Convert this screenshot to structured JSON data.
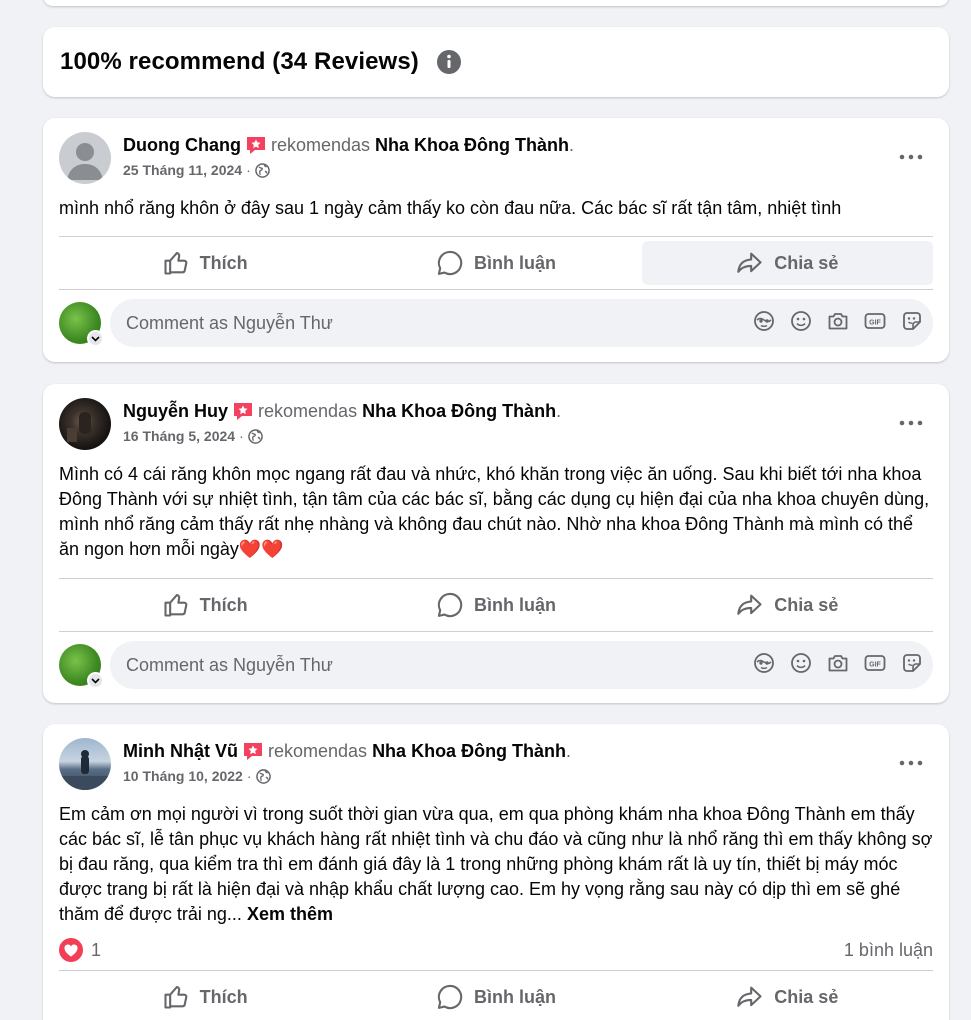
{
  "summary": {
    "title": "100% recommend (34 Reviews)"
  },
  "comment_placeholder": "Comment as Nguyễn Thư",
  "actions": {
    "like": "Thích",
    "comment": "Bình luận",
    "share": "Chia sẻ"
  },
  "reviews": [
    {
      "author": "Duong Chang",
      "recommends": "rekomendas",
      "page": "Nha Khoa Đông Thành",
      "date": "25 Tháng 11, 2024",
      "text": "mình nhổ răng khôn ở đây sau 1 ngày cảm thấy ko còn đau nữa. Các bác sĩ rất tận tâm, nhiệt tình"
    },
    {
      "author": "Nguyễn Huy",
      "recommends": "rekomendas",
      "page": "Nha Khoa Đông Thành",
      "date": "16 Tháng 5, 2024",
      "text": "Mình có 4 cái răng khôn mọc ngang rất đau và nhức, khó khăn trong việc ăn uống. Sau khi biết tới nha khoa Đông Thành với sự nhiệt tình, tận tâm của các bác sĩ, bằng các dụng cụ hiện đại của nha khoa chuyên dùng, mình nhổ răng cảm thấy rất nhẹ nhàng và không đau chút nào. Nhờ nha khoa Đông Thành mà mình có thể ăn ngon hơn mỗi ngày❤️❤️"
    },
    {
      "author": "Minh Nhật Vũ",
      "recommends": "rekomendas",
      "page": "Nha Khoa Đông Thành",
      "date": "10 Tháng 10, 2022",
      "text": "Em cảm ơn mọi người vì trong suốt thời gian vừa qua, em qua phòng khám nha khoa Đông Thành em thấy các bác sĩ, lễ tân phục vụ khách hàng rất nhiệt tình và chu đáo và cũng như là nhổ răng thì em thấy không sợ bị đau răng, qua kiểm tra thì em đánh giá đây là 1 trong những phòng khám rất là uy tín, thiết bị máy móc được trang bị rất là hiện đại và nhập khẩu chất lượng cao. Em hy vọng rằng sau này có dịp thì em sẽ ghé thăm để được trải ng...",
      "see_more": "Xem thêm",
      "reaction_count": "1",
      "comment_count": "1 bình luận"
    }
  ]
}
